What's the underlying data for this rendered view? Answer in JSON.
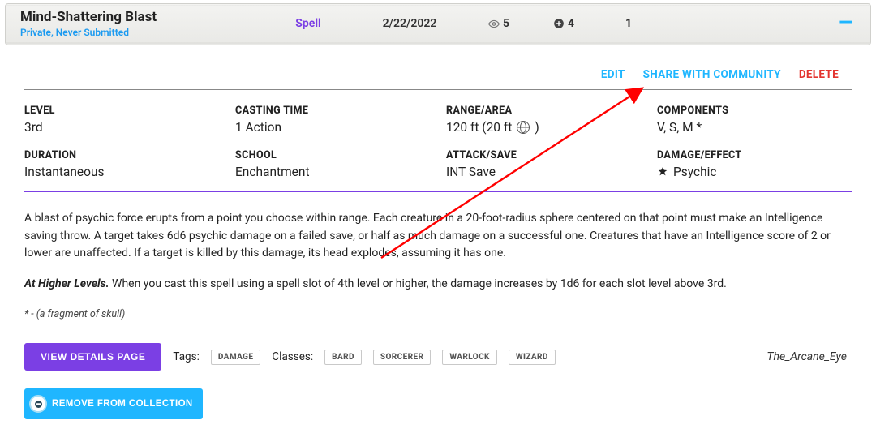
{
  "header": {
    "title": "Mind-Shattering Blast",
    "subtitle": "Private, Never Submitted",
    "type_label": "Spell",
    "date": "2/22/2022",
    "views": "5",
    "adds": "4",
    "comments": "1"
  },
  "actions": {
    "edit": "EDIT",
    "share": "SHARE WITH COMMUNITY",
    "delete": "DELETE"
  },
  "stats": {
    "level_label": "LEVEL",
    "level_value": "3rd",
    "casting_label": "CASTING TIME",
    "casting_value": "1 Action",
    "range_label": "RANGE/AREA",
    "range_value": "120 ft (20 ft",
    "range_suffix": ")",
    "components_label": "COMPONENTS",
    "components_value": "V, S, M *",
    "duration_label": "DURATION",
    "duration_value": "Instantaneous",
    "school_label": "SCHOOL",
    "school_value": "Enchantment",
    "attack_label": "ATTACK/SAVE",
    "attack_value": "INT Save",
    "damage_label": "DAMAGE/EFFECT",
    "damage_value": "Psychic"
  },
  "description": {
    "p1": "A blast of psychic force erupts from a point you choose within range. Each creature in a 20-foot-radius sphere centered on that point must make an Intelligence saving throw. A target takes 6d6 psychic damage on a failed save, or half as much damage on a successful one. Creatures that have an Intelligence score of 2 or lower are unaffected. If a target is killed by this damage, its head explodes, assuming it has one.",
    "higher_label": "At Higher Levels.",
    "higher_text": " When you cast this spell using a spell slot of 4th level or higher, the damage increases by 1d6 for each slot level above 3rd.",
    "material": "* - (a fragment of skull)"
  },
  "bottom": {
    "details_btn": "VIEW DETAILS PAGE",
    "tags_label": "Tags:",
    "tags": [
      "DAMAGE"
    ],
    "classes_label": "Classes:",
    "classes": [
      "BARD",
      "SORCERER",
      "WARLOCK",
      "WIZARD"
    ],
    "author": "The_Arcane_Eye",
    "remove_btn": "REMOVE FROM COLLECTION"
  }
}
